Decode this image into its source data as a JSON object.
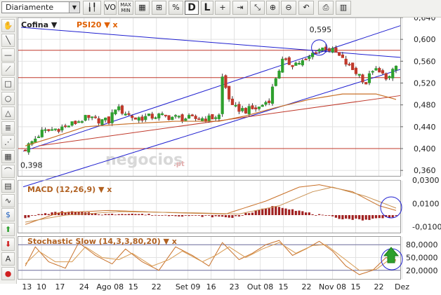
{
  "toolbar": {
    "period": "Diariamente",
    "buttons": [
      {
        "name": "candle-chart-button",
        "label": "",
        "icon": "candlestick-icon"
      },
      {
        "name": "volume-button",
        "label": "VOL",
        "icon": ""
      },
      {
        "name": "maxmin-button",
        "label": "MAX MIN",
        "icon": ""
      },
      {
        "name": "grid-button",
        "label": "",
        "icon": "grid-icon"
      },
      {
        "name": "log-scale-button",
        "label": "",
        "icon": "log-scale-icon"
      },
      {
        "name": "percent-button",
        "label": "",
        "icon": "percent-icon"
      },
      {
        "name": "daily-d-button",
        "label": "D",
        "icon": ""
      },
      {
        "name": "line-l-button",
        "label": "L",
        "icon": ""
      },
      {
        "name": "crosshair-button",
        "label": "",
        "icon": "crosshair-icon"
      },
      {
        "name": "last-value-button",
        "label": "",
        "icon": "last-value-icon"
      },
      {
        "name": "pan-button",
        "label": "",
        "icon": "pan-icon"
      },
      {
        "name": "zoom-in-button",
        "label": "",
        "icon": "zoom-in-icon"
      },
      {
        "name": "zoom-out-button",
        "label": "",
        "icon": "zoom-out-icon"
      },
      {
        "name": "undo-button",
        "label": "",
        "icon": "undo-icon"
      },
      {
        "name": "print-button",
        "label": "",
        "icon": "print-icon"
      },
      {
        "name": "help-button",
        "label": "",
        "icon": "book-icon"
      }
    ]
  },
  "left_tools": [
    "hand-icon",
    "line-icon",
    "horizontal-line-icon",
    "trend-line-icon",
    "rectangle-icon",
    "ellipse-icon",
    "triangle-icon",
    "fibonacci-icon",
    "fan-icon",
    "gann-grid-icon",
    "arc-icon",
    "channel-icon",
    "cycle-icon",
    "dollar-icon",
    "buy-arrow-icon",
    "sell-arrow-icon",
    "text-icon",
    "delete-icon"
  ],
  "colors": {
    "up": "#2ea02e",
    "down": "#c0392b",
    "blue": "#1f1fd0",
    "red_line": "#c0392b",
    "macd_line": "#c87028",
    "macd_hist": "#a02020",
    "stoch": "#c87028",
    "grid": "#e2e2e2"
  },
  "legend": {
    "symbol": "Cofina",
    "compare": "PSI20",
    "macd": "MACD (12,26,9)",
    "stoch": "Stochastic Slow (14,3,3,80,20)"
  },
  "annotations": {
    "max_label": "0,595",
    "min_label": "0,398"
  },
  "watermark": {
    "text": "negocios",
    "sub": ".pt"
  },
  "chart_data": [
    {
      "type": "candlestick",
      "title": "Cofina",
      "ylim": [
        0.35,
        0.64
      ],
      "y_ticks": [
        "0,640",
        "0,600",
        "0,560",
        "0,520",
        "0,480",
        "0,440",
        "0,400",
        "0,360"
      ],
      "x_ticks": [
        "13",
        "10",
        "17",
        "24",
        "Ago 08",
        "15",
        "22",
        "Set 09",
        "16",
        "23",
        "Out 08",
        "15",
        "22",
        "Nov 08",
        "15",
        "22",
        "Dez"
      ],
      "n_periods": 112,
      "grid": true,
      "ohlc_anchors": [
        {
          "i": 0,
          "close": 0.4
        },
        {
          "i": 5,
          "close": 0.43
        },
        {
          "i": 12,
          "close": 0.44
        },
        {
          "i": 18,
          "close": 0.455
        },
        {
          "i": 25,
          "close": 0.45
        },
        {
          "i": 27,
          "close": 0.475
        },
        {
          "i": 33,
          "close": 0.455
        },
        {
          "i": 40,
          "close": 0.46
        },
        {
          "i": 48,
          "close": 0.455
        },
        {
          "i": 55,
          "close": 0.455
        },
        {
          "i": 58,
          "close": 0.46
        },
        {
          "i": 59,
          "close": 0.53
        },
        {
          "i": 62,
          "close": 0.475
        },
        {
          "i": 66,
          "close": 0.47
        },
        {
          "i": 70,
          "close": 0.475
        },
        {
          "i": 73,
          "close": 0.49
        },
        {
          "i": 75,
          "close": 0.53
        },
        {
          "i": 77,
          "close": 0.56
        },
        {
          "i": 80,
          "close": 0.555
        },
        {
          "i": 84,
          "close": 0.56
        },
        {
          "i": 87,
          "close": 0.58
        },
        {
          "i": 90,
          "close": 0.585
        },
        {
          "i": 93,
          "close": 0.575
        },
        {
          "i": 97,
          "close": 0.55
        },
        {
          "i": 100,
          "close": 0.535
        },
        {
          "i": 102,
          "close": 0.52
        },
        {
          "i": 104,
          "close": 0.545
        },
        {
          "i": 107,
          "close": 0.535
        },
        {
          "i": 109,
          "close": 0.53
        },
        {
          "i": 111,
          "close": 0.55
        }
      ],
      "moving_average": [
        {
          "i": 0,
          "v": 0.405
        },
        {
          "i": 8,
          "v": 0.42
        },
        {
          "i": 18,
          "v": 0.44
        },
        {
          "i": 30,
          "v": 0.445
        },
        {
          "i": 45,
          "v": 0.45
        },
        {
          "i": 58,
          "v": 0.45
        },
        {
          "i": 66,
          "v": 0.46
        },
        {
          "i": 75,
          "v": 0.475
        },
        {
          "i": 85,
          "v": 0.49
        },
        {
          "i": 95,
          "v": 0.5
        },
        {
          "i": 105,
          "v": 0.5
        },
        {
          "i": 111,
          "v": 0.49
        }
      ],
      "reference_lines": [
        0.58,
        0.53,
        0.4
      ],
      "max_value": 0.595,
      "min_value": 0.398
    },
    {
      "type": "macd",
      "title": "MACD (12,26,9)",
      "ylim": [
        -0.015,
        0.03
      ],
      "y_ticks": [
        "0,0300",
        "0,0100",
        "-0,0100"
      ],
      "histogram_anchors": [
        {
          "i": 0,
          "v": -0.002
        },
        {
          "i": 5,
          "v": 0.001
        },
        {
          "i": 12,
          "v": 0.003
        },
        {
          "i": 18,
          "v": 0.002
        },
        {
          "i": 25,
          "v": 0.0005
        },
        {
          "i": 30,
          "v": 0.0015
        },
        {
          "i": 40,
          "v": 0.0
        },
        {
          "i": 55,
          "v": -0.001
        },
        {
          "i": 62,
          "v": -0.002
        },
        {
          "i": 75,
          "v": 0.008
        },
        {
          "i": 80,
          "v": 0.005
        },
        {
          "i": 86,
          "v": 0.001
        },
        {
          "i": 95,
          "v": -0.003
        },
        {
          "i": 102,
          "v": -0.004
        },
        {
          "i": 111,
          "v": -0.001
        }
      ],
      "line_anchors": [
        {
          "i": 0,
          "v": -0.008
        },
        {
          "i": 10,
          "v": 0.002
        },
        {
          "i": 25,
          "v": 0.004
        },
        {
          "i": 45,
          "v": 0.002
        },
        {
          "i": 60,
          "v": 0.001
        },
        {
          "i": 72,
          "v": 0.012
        },
        {
          "i": 82,
          "v": 0.024
        },
        {
          "i": 88,
          "v": 0.026
        },
        {
          "i": 98,
          "v": 0.02
        },
        {
          "i": 106,
          "v": 0.008
        },
        {
          "i": 111,
          "v": 0.004
        }
      ],
      "signal_anchors": [
        {
          "i": 0,
          "v": -0.006
        },
        {
          "i": 12,
          "v": 0.0
        },
        {
          "i": 28,
          "v": 0.003
        },
        {
          "i": 50,
          "v": 0.002
        },
        {
          "i": 64,
          "v": 0.001
        },
        {
          "i": 76,
          "v": 0.008
        },
        {
          "i": 86,
          "v": 0.02
        },
        {
          "i": 92,
          "v": 0.024
        },
        {
          "i": 102,
          "v": 0.016
        },
        {
          "i": 111,
          "v": 0.006
        }
      ]
    },
    {
      "type": "stochastic",
      "title": "Stochastic Slow (14,3,3,80,20)",
      "ylim": [
        0,
        100
      ],
      "y_ticks": [
        "80,0000",
        "50,0000",
        "20,0000"
      ],
      "levels": [
        80,
        20
      ],
      "k_anchors": [
        {
          "i": 0,
          "v": 30
        },
        {
          "i": 3,
          "v": 75
        },
        {
          "i": 7,
          "v": 40
        },
        {
          "i": 12,
          "v": 25
        },
        {
          "i": 16,
          "v": 85
        },
        {
          "i": 21,
          "v": 55
        },
        {
          "i": 26,
          "v": 35
        },
        {
          "i": 30,
          "v": 70
        },
        {
          "i": 35,
          "v": 40
        },
        {
          "i": 40,
          "v": 20
        },
        {
          "i": 45,
          "v": 75
        },
        {
          "i": 50,
          "v": 55
        },
        {
          "i": 55,
          "v": 30
        },
        {
          "i": 59,
          "v": 85
        },
        {
          "i": 64,
          "v": 45
        },
        {
          "i": 68,
          "v": 60
        },
        {
          "i": 72,
          "v": 80
        },
        {
          "i": 76,
          "v": 90
        },
        {
          "i": 80,
          "v": 55
        },
        {
          "i": 84,
          "v": 70
        },
        {
          "i": 88,
          "v": 88
        },
        {
          "i": 92,
          "v": 65
        },
        {
          "i": 96,
          "v": 30
        },
        {
          "i": 100,
          "v": 10
        },
        {
          "i": 104,
          "v": 20
        },
        {
          "i": 108,
          "v": 50
        },
        {
          "i": 111,
          "v": 42
        }
      ],
      "d_anchors": [
        {
          "i": 0,
          "v": 35
        },
        {
          "i": 4,
          "v": 65
        },
        {
          "i": 9,
          "v": 40
        },
        {
          "i": 14,
          "v": 40
        },
        {
          "i": 18,
          "v": 75
        },
        {
          "i": 23,
          "v": 50
        },
        {
          "i": 28,
          "v": 45
        },
        {
          "i": 32,
          "v": 60
        },
        {
          "i": 38,
          "v": 30
        },
        {
          "i": 43,
          "v": 45
        },
        {
          "i": 47,
          "v": 65
        },
        {
          "i": 53,
          "v": 40
        },
        {
          "i": 57,
          "v": 55
        },
        {
          "i": 61,
          "v": 75
        },
        {
          "i": 66,
          "v": 50
        },
        {
          "i": 71,
          "v": 70
        },
        {
          "i": 76,
          "v": 85
        },
        {
          "i": 81,
          "v": 60
        },
        {
          "i": 86,
          "v": 78
        },
        {
          "i": 90,
          "v": 80
        },
        {
          "i": 95,
          "v": 50
        },
        {
          "i": 100,
          "v": 20
        },
        {
          "i": 105,
          "v": 22
        },
        {
          "i": 109,
          "v": 45
        },
        {
          "i": 111,
          "v": 45
        }
      ]
    }
  ]
}
